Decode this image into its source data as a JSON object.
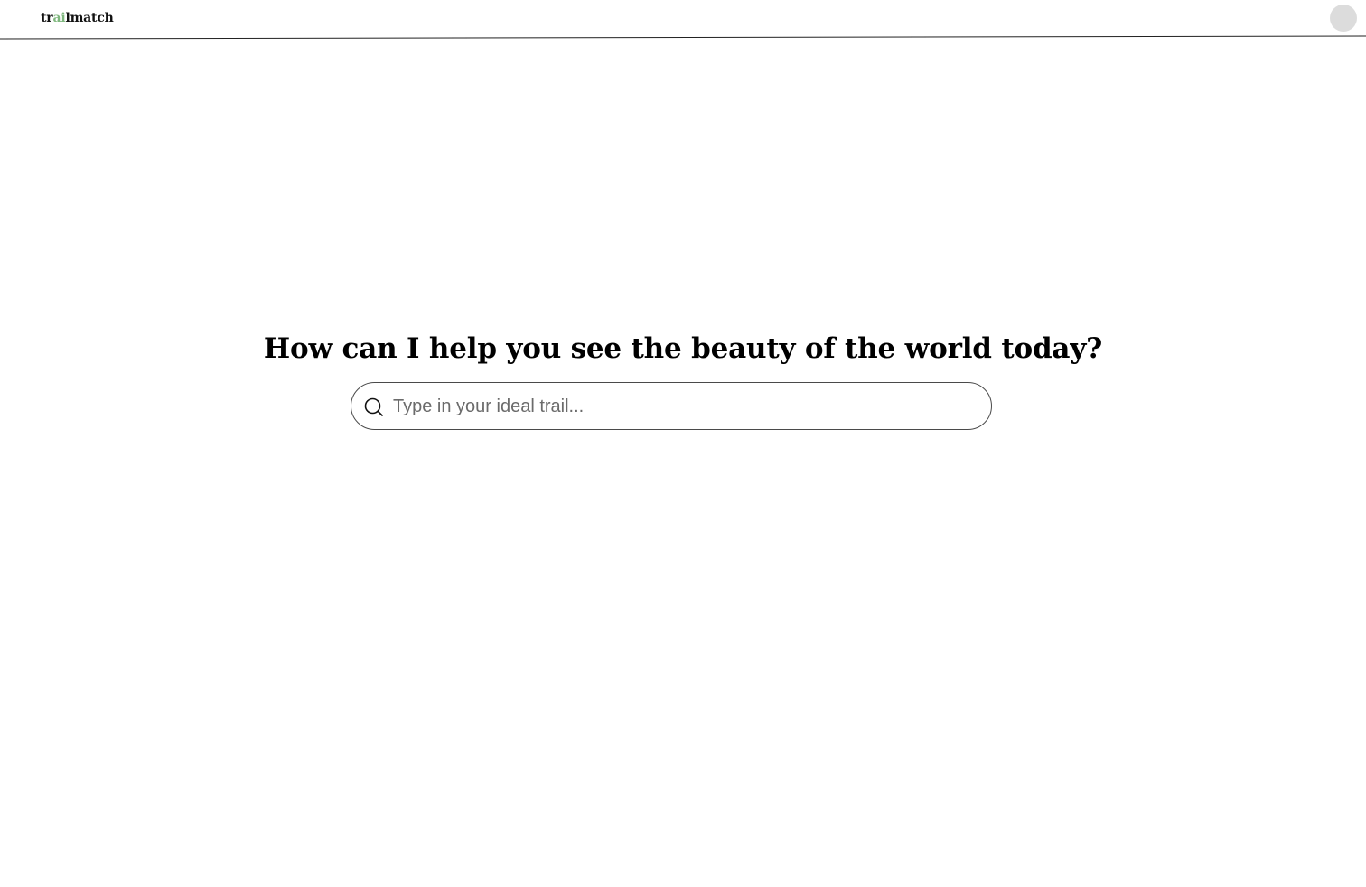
{
  "header": {
    "logo_prefix": "tr",
    "logo_accent": "ai",
    "logo_suffix": "lmatch",
    "accent_color": "#7fb77e"
  },
  "main": {
    "headline": "How can I help you see the beauty of the world today?",
    "search": {
      "placeholder": "Type in your ideal trail...",
      "value": "",
      "icon": "search-icon"
    }
  }
}
